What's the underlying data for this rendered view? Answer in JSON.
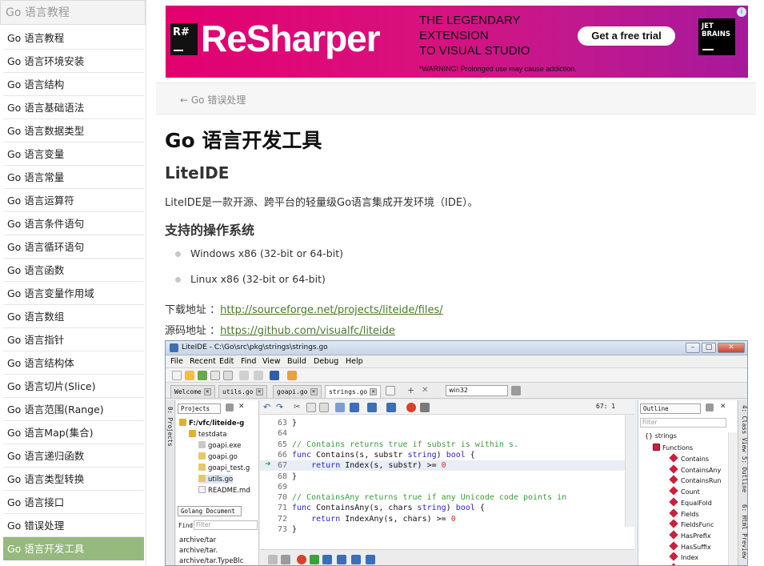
{
  "sidebar": {
    "title": "Go 语言教程",
    "items": [
      "Go 语言教程",
      "Go 语言环境安装",
      "Go 语言结构",
      "Go 语言基础语法",
      "Go 语言数据类型",
      "Go 语言变量",
      "Go 语言常量",
      "Go 语言运算符",
      "Go 语言条件语句",
      "Go 语言循环语句",
      "Go 语言函数",
      "Go 语言变量作用域",
      "Go 语言数组",
      "Go 语言指针",
      "Go 语言结构体",
      "Go 语言切片(Slice)",
      "Go 语言范围(Range)",
      "Go 语言Map(集合)",
      "Go 语言递归函数",
      "Go 语言类型转换",
      "Go 语言接口",
      "Go 错误处理",
      "Go 语言开发工具"
    ],
    "active_index": 22
  },
  "ad": {
    "r_logo": "R#",
    "brand": "ReSharper",
    "line1": "THE LEGENDARY",
    "line2": "EXTENSION",
    "line3": "TO VISUAL STUDIO",
    "warning": "*WARNING! Prolonged use may cause addiction.",
    "cta": "Get a free trial",
    "jb_line1": "JET",
    "jb_line2": "BRAINS",
    "info": "i"
  },
  "nav": {
    "prev": "← Go 错误处理"
  },
  "article": {
    "title": "Go 语言开发工具",
    "subtitle": "LiteIDE",
    "intro": "LiteIDE是一款开源、跨平台的轻量级Go语言集成开发环境（IDE）。",
    "os_heading": "支持的操作系统",
    "os_items": [
      "Windows x86 (32-bit or 64-bit)",
      "Linux x86 (32-bit or 64-bit)"
    ],
    "download_label": "下载地址 ：",
    "download_url": "http://sourceforge.net/projects/liteide/files/",
    "source_label": "源码地址 ：",
    "source_url": "https://github.com/visualfc/liteide"
  },
  "ide": {
    "title": "LiteIDE - C:\\Go\\src\\pkg\\strings\\strings.go",
    "window_buttons": [
      "–",
      "□",
      "✕"
    ],
    "menu": [
      "File",
      "Recent",
      "Edit",
      "Find",
      "View",
      "Build",
      "Debug",
      "Help"
    ],
    "tabs": [
      "Welcome",
      "utils.go",
      "goapi.go",
      "strings.go"
    ],
    "active_tab": 3,
    "platform": "win32",
    "left_rail": "0: Projects",
    "projects_combo": "Projects",
    "project_tree": [
      "F:/vfc/liteide-g",
      "testdata",
      "goapi.exe",
      "goapi.go",
      "goapi_test.g",
      "utils.go",
      "README.md"
    ],
    "golang_doc_combo": "Golang Document",
    "find_label": "Find",
    "filter_placeholder": "Filter",
    "doc_items": [
      "archive/tar",
      "archive/tar.",
      "archive/tar.TypeBlc"
    ],
    "line_position": "67:  1",
    "code_lines": [
      {
        "n": "63",
        "t": "}"
      },
      {
        "n": "64",
        "t": ""
      },
      {
        "n": "65",
        "t": "// Contains returns true if substr is within s."
      },
      {
        "n": "66",
        "t": "func Contains(s, substr string) bool {"
      },
      {
        "n": "67",
        "t": "    return Index(s, substr) >= 0"
      },
      {
        "n": "68",
        "t": "}"
      },
      {
        "n": "69",
        "t": ""
      },
      {
        "n": "70",
        "t": "// ContainsAny returns true if any Unicode code points in"
      },
      {
        "n": "71",
        "t": "func ContainsAny(s, chars string) bool {"
      },
      {
        "n": "72",
        "t": "    return IndexAny(s, chars) >= 0"
      },
      {
        "n": "73",
        "t": "}"
      }
    ],
    "current_line_index": 4,
    "outline_combo": "Outline",
    "outline_filter": "Filter",
    "outline_root": "{} strings",
    "outline_group": "Functions",
    "outline_items": [
      "Contains",
      "ContainsAny",
      "ContainsRun",
      "Count",
      "EqualFold",
      "Fields",
      "FieldsFunc",
      "HasPrefix",
      "HasSuffix",
      "Index",
      "IndexAny"
    ],
    "right_rail": [
      "4: Class View",
      "5: Outline",
      "6: Html Preview"
    ]
  }
}
